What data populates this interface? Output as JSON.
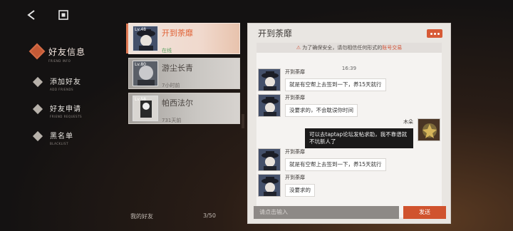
{
  "nav": {
    "items": [
      {
        "label": "好友信息",
        "sub": "FRIEND INFO"
      },
      {
        "label": "添加好友",
        "sub": "ADD FRIENDS"
      },
      {
        "label": "好友申请",
        "sub": "FRIEND REQUESTS"
      },
      {
        "label": "黑名单",
        "sub": "BLACKLIST"
      }
    ]
  },
  "friends": [
    {
      "level": "Lv.48",
      "name": "开到荼靡",
      "status": "在线"
    },
    {
      "level": "Lv.80",
      "name": "游尘长青",
      "status": "7小时前"
    },
    {
      "level": "Lv.58",
      "name": "帕西法尔",
      "status": "731天前"
    }
  ],
  "footer": {
    "label": "我的好友",
    "count": "3/50"
  },
  "chat": {
    "title": "开到荼靡",
    "notice_prefix": "为了确保安全，请勿相信任何形式的",
    "notice_highlight": "账号交易",
    "time": "16:39",
    "messages": [
      {
        "side": "left",
        "name": "开到荼靡",
        "text": "就是有空帮上去签到一下，养15天就行"
      },
      {
        "side": "left",
        "name": "开到荼靡",
        "text": "没要求的，不会耽误你时间"
      },
      {
        "side": "right",
        "name": "木朵",
        "text": "可以去taptap论坛发帖求助，我不靠谱就不坑新人了"
      },
      {
        "side": "left",
        "name": "开到荼靡",
        "text": "就是有空帮上去签到一下，养15天就行"
      },
      {
        "side": "left",
        "name": "开到荼靡",
        "text": "没要求的"
      }
    ],
    "input_placeholder": "请点击输入",
    "send_label": "发送"
  },
  "colors": {
    "accent": "#d0532e",
    "online": "#5ea365"
  }
}
